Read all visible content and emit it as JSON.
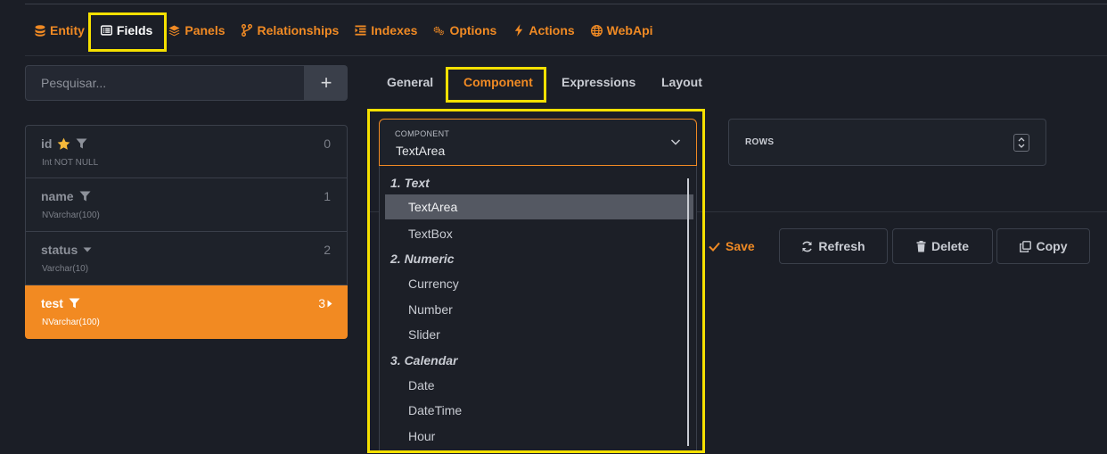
{
  "nav": {
    "items": [
      {
        "label": "Entity",
        "icon": "database-icon"
      },
      {
        "label": "Fields",
        "icon": "list-icon"
      },
      {
        "label": "Panels",
        "icon": "layers-icon"
      },
      {
        "label": "Relationships",
        "icon": "branch-icon"
      },
      {
        "label": "Indexes",
        "icon": "index-icon"
      },
      {
        "label": "Options",
        "icon": "gears-icon"
      },
      {
        "label": "Actions",
        "icon": "bolt-icon"
      },
      {
        "label": "WebApi",
        "icon": "globe-icon"
      }
    ],
    "active": "Fields"
  },
  "search": {
    "placeholder": "Pesquisar...",
    "add_label": "+"
  },
  "fields": [
    {
      "name": "id",
      "type": "Int NOT NULL",
      "index": "0",
      "icons": [
        "star-icon",
        "filter-icon"
      ]
    },
    {
      "name": "name",
      "type": "NVarchar(100)",
      "index": "1",
      "icons": [
        "filter-icon"
      ]
    },
    {
      "name": "status",
      "type": "Varchar(10)",
      "index": "2",
      "icons": [
        "caret-down-icon"
      ]
    },
    {
      "name": "test",
      "type": "NVarchar(100)",
      "index": "3",
      "icons": [
        "filter-icon"
      ],
      "selected": true
    }
  ],
  "tabs": [
    {
      "label": "General"
    },
    {
      "label": "Component",
      "active": true
    },
    {
      "label": "Expressions"
    },
    {
      "label": "Layout"
    }
  ],
  "component": {
    "caption": "COMPONENT",
    "value": "TextArea",
    "groups": [
      {
        "label": "1. Text",
        "options": [
          "TextArea",
          "TextBox"
        ]
      },
      {
        "label": "2. Numeric",
        "options": [
          "Currency",
          "Number",
          "Slider"
        ]
      },
      {
        "label": "3. Calendar",
        "options": [
          "Date",
          "DateTime",
          "Hour"
        ]
      }
    ]
  },
  "rows": {
    "label": "ROWS"
  },
  "actions": {
    "save": "Save",
    "refresh": "Refresh",
    "delete": "Delete",
    "copy": "Copy"
  },
  "colors": {
    "accent": "#f08a24",
    "highlight": "#f5e000",
    "background": "#1b1e26"
  }
}
